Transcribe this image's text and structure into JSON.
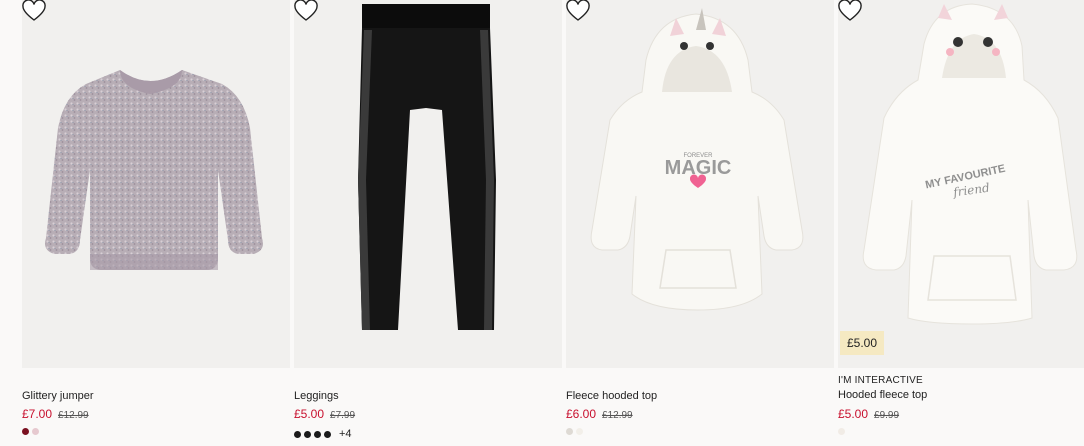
{
  "products": [
    {
      "name": "Glittery jumper",
      "price": "£7.00",
      "was_price": "£12.99",
      "swatches": [
        "#7a1020",
        "#e6c9cf"
      ]
    },
    {
      "name": "Leggings",
      "price": "£5.00",
      "was_price": "£7.99",
      "swatches": [
        "#1b1b1b",
        "#1b1b1b",
        "#1b1b1b",
        "#1b1b1b"
      ],
      "more_colors": "+4"
    },
    {
      "name": "Fleece hooded top",
      "price": "£6.00",
      "was_price": "£12.99",
      "swatches": [
        "#dedad4",
        "#f2efe9"
      ]
    },
    {
      "brand": "I'M INTERACTIVE",
      "name": "Hooded fleece top",
      "price": "£5.00",
      "was_price": "£9.99",
      "badge": "£5.00",
      "swatches": [
        "#f1ece6"
      ]
    }
  ],
  "print_text": {
    "magic_top": "FOREVER",
    "magic": "MAGIC",
    "fav_line1": "MY FAVOURITE",
    "fav_line2": "friend"
  },
  "colors": {
    "sale_price": "#c8102e",
    "background": "#faf9f8",
    "image_bg": "#f1f0ee",
    "badge_bg": "#f5e9c2"
  }
}
